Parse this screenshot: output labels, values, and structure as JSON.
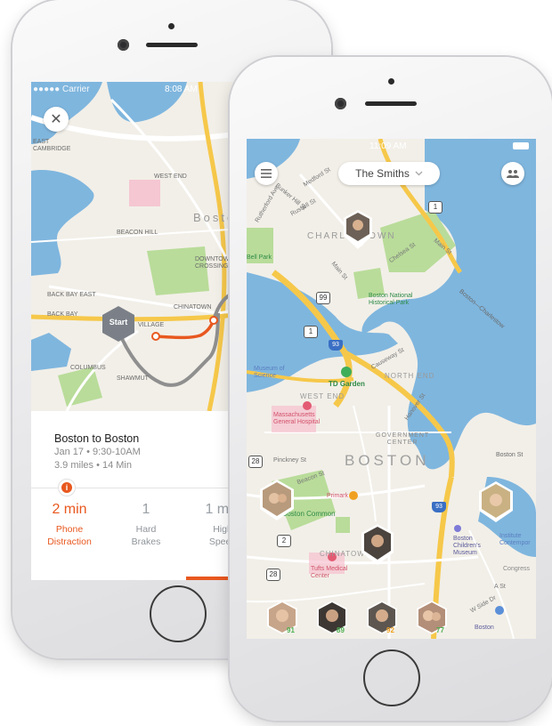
{
  "back_phone": {
    "status": {
      "carrier": "●●●●● Carrier",
      "time": "8:08 AM"
    },
    "map_labels": {
      "east_cambridge": "EAST\nCAMBRIDGE",
      "west_end": "WEST END",
      "boston": "Boston",
      "beacon_hill": "BEACON HILL",
      "downtown_crossing": "DOWNTOWN\nCROSSING",
      "back_bay_east": "BACK BAY EAST",
      "back_bay": "BACK BAY",
      "village": "VILLAGE",
      "chinatown": "CHINATOWN",
      "columbus": "COLUMBUS",
      "shawmut": "SHAWMUT"
    },
    "start_label": "Start",
    "trip": {
      "title": "Boston to Boston",
      "date": "Jan 17 • 9:30-10AM",
      "distance": "3.9 miles • 14 Min"
    },
    "stats": [
      {
        "value": "2 min",
        "label": "Phone Distraction",
        "active": true
      },
      {
        "value": "1",
        "label": "Hard Brakes",
        "active": false
      },
      {
        "value": "1 min",
        "label": "High Speed",
        "active": false
      }
    ],
    "alert_icon": "i"
  },
  "front_phone": {
    "status": {
      "time": "11:09 AM"
    },
    "family_name": "The Smiths",
    "map_labels": {
      "charlestown": "CHARLESTOWN",
      "north_end": "NORTH END",
      "west_end": "WEST END",
      "government_center": "GOVERNMENT\nCENTER",
      "boston": "BOSTON",
      "chinatown": "CHINATOWN",
      "td_garden": "TD Garden",
      "mass_general": "Massachusetts\nGeneral Hospital",
      "boston_common": "Boston Common",
      "museum_of_science": "Museum of\nScience",
      "bunker_hill_park": "Boston National\nHistorical Park",
      "tufts": "Tufts Medical\nCenter",
      "childrens_museum": "Boston\nChildren's\nMuseum",
      "primark": "Primark",
      "congress": "Congress",
      "institute": "Institute\nContempor",
      "bell_park": "Bell Park",
      "medford_st": "Medford St",
      "main_st_1": "Main St",
      "main_st_2": "Main St",
      "beacon_st": "Beacon St",
      "pinckney_st": "Pinckney St",
      "hanover_st": "Hanover St",
      "chelsea_st": "Chelsea St",
      "bunker_hill_st": "Bunker Hill St",
      "rutherford_ave": "Rutherford Ave",
      "russell_st": "Russell St",
      "boston_st": "Boston St",
      "causeway_st": "Causeway St",
      "boston_charlestown": "Boston—Charlestow",
      "a_st": "A St",
      "w_side_dr": "W Side Dr",
      "boston_bottom": "Boston"
    },
    "route_shields": [
      "1",
      "1",
      "93",
      "93",
      "99",
      "28",
      "2",
      "2",
      "28",
      "1"
    ],
    "members": [
      {
        "score": "91",
        "score_color": "#4caf50"
      },
      {
        "score": "89",
        "score_color": "#4caf50"
      },
      {
        "score": "92",
        "score_color": "#f0a020"
      },
      {
        "score": "77",
        "score_color": "#4caf50"
      }
    ]
  },
  "colors": {
    "accent": "#e8581f",
    "water": "#7fb6de",
    "park": "#b9dc9a",
    "land": "#f2efe8",
    "highway": "#f6c84a"
  }
}
